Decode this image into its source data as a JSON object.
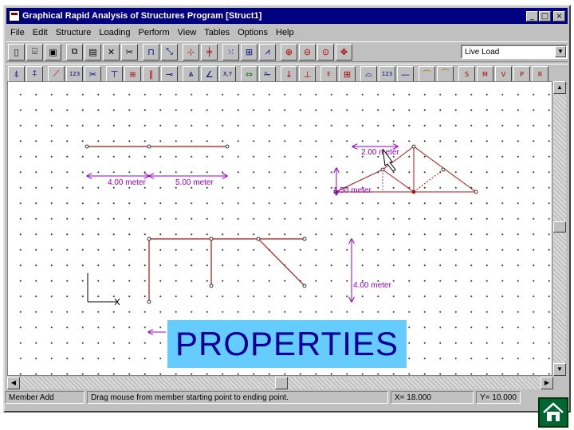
{
  "window": {
    "title": "Graphical Rapid Analysis of Structures Program [Struct1]",
    "buttons": {
      "minimize": "_",
      "maximize": "□",
      "close": "×"
    }
  },
  "menu": [
    "File",
    "Edit",
    "Structure",
    "Loading",
    "Perform",
    "View",
    "Tables",
    "Options",
    "Help"
  ],
  "toolbar1": {
    "icons": [
      "new-icon",
      "open-icon",
      "save-icon",
      "copy-icon",
      "paste-icon",
      "delete-icon",
      "cut-icon",
      "frame-icon",
      "zoom-window-icon",
      "grid-snap-icon",
      "member-icon",
      "grid-icon",
      "frame-view-icon",
      "truss-view-icon",
      "zoom-in-icon",
      "zoom-out-icon",
      "zoom-all-icon",
      "pan-icon"
    ],
    "load_case_selected": "Live Load"
  },
  "toolbar2": {
    "icons": [
      "node-add-icon",
      "member-add-icon",
      "member-icon",
      "dimension-icon",
      "delete-member-icon",
      "support-icon",
      "spring-icon",
      "hinge-icon",
      "release-icon",
      "truss-icon",
      "angle-icon",
      "axis-icon",
      "move-icon",
      "scissors-icon",
      "point-load-icon",
      "moment-icon",
      "properties-icon",
      "table-icon",
      "distributed-load-icon",
      "load-value-icon",
      "line-icon",
      "deflection-icon",
      "shape-icon",
      "shear-icon",
      "moment-diagram-icon",
      "axial-icon",
      "reaction-icon",
      "parameter-icon",
      "result-icon"
    ],
    "glyphs": {
      "number_label": "123",
      "s_label": "S",
      "m_label": "M",
      "v_label": "V",
      "p_label": "P",
      "r_label": "R",
      "e_label": "E",
      "xy_label": "X,Y"
    }
  },
  "drawing": {
    "dimension_labels": {
      "beam_span1": "4.00 meter",
      "beam_span2": "5.00 meter",
      "truss_width": "2.00 meter",
      "truss_height": "1.50 meter",
      "frame_height": "4.00 meter"
    }
  },
  "status": {
    "mode": "Member Add",
    "hint": "Drag mouse from member starting point to ending point.",
    "x_readout": "X= 18.000",
    "y_readout": "Y= 10.000"
  },
  "overlay": {
    "text": "PROPERTIES"
  },
  "colors": {
    "member": "#b01010",
    "dimension": "#9900cc",
    "title_bar": "#000080",
    "overlay_bg": "#66ccff",
    "overlay_text": "#000099",
    "home_button": "#006633"
  }
}
